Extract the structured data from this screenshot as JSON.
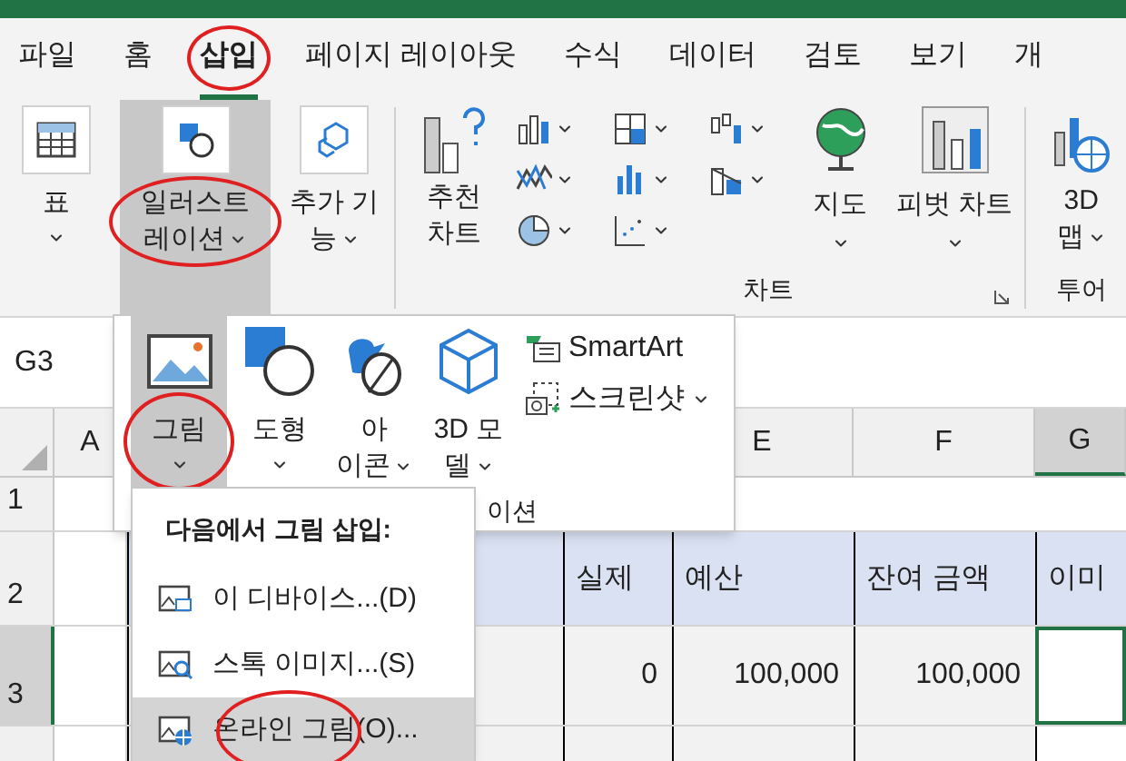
{
  "tabs": [
    {
      "label": "파일",
      "selected": false,
      "circled": false
    },
    {
      "label": "홈",
      "selected": false,
      "circled": false
    },
    {
      "label": "삽입",
      "selected": true,
      "circled": true
    },
    {
      "label": "페이지 레이아웃",
      "selected": false,
      "circled": false
    },
    {
      "label": "수식",
      "selected": false,
      "circled": false
    },
    {
      "label": "데이터",
      "selected": false,
      "circled": false
    },
    {
      "label": "검토",
      "selected": false,
      "circled": false
    },
    {
      "label": "보기",
      "selected": false,
      "circled": false
    },
    {
      "label": "개",
      "selected": false,
      "circled": false
    }
  ],
  "ribbon": {
    "left_buttons": [
      {
        "kind": "table",
        "lines": [
          "표"
        ],
        "pressed": false,
        "circled": false
      },
      {
        "kind": "illustration",
        "lines": [
          "일러스트",
          "레이션"
        ],
        "pressed": true,
        "circled": true
      },
      {
        "kind": "addin",
        "lines": [
          "추가 기",
          "능"
        ],
        "pressed": false,
        "circled": false
      }
    ],
    "charts_group": {
      "recommended": [
        "추천",
        "차트"
      ],
      "map": "지도",
      "pivot": "피벗 차트",
      "label": "차트"
    },
    "tour_group": {
      "button": [
        "3D",
        "맵"
      ],
      "label": "투어"
    }
  },
  "name_box": "G3",
  "gallery": {
    "items": [
      {
        "kind": "picture",
        "lines": [
          "그림"
        ],
        "pressed": true,
        "circled": true
      },
      {
        "kind": "shapes",
        "lines": [
          "도형"
        ],
        "pressed": false,
        "circled": false
      },
      {
        "kind": "icons",
        "lines": [
          "아",
          "이콘"
        ],
        "pressed": false,
        "circled": false
      },
      {
        "kind": "model3d",
        "lines": [
          "3D 모",
          "델"
        ],
        "pressed": false,
        "circled": false
      }
    ],
    "smartart": "SmartArt",
    "screenshot": "스크린샷",
    "group_label": "이션"
  },
  "picture_menu": {
    "title": "다음에서 그림 삽입:",
    "items": [
      {
        "kind": "device",
        "label": "이 디바이스...(D)",
        "selected": false,
        "circled": false
      },
      {
        "kind": "stock",
        "label": "스톡 이미지...(S)",
        "selected": false,
        "circled": false
      },
      {
        "kind": "online",
        "label": "온라인 그림(O)...",
        "selected": true,
        "circled": true
      }
    ]
  },
  "column_headers": [
    {
      "label": "A",
      "selected": false
    },
    {
      "label": "E",
      "selected": false
    },
    {
      "label": "F",
      "selected": false
    },
    {
      "label": "G",
      "selected": true
    }
  ],
  "rows": [
    {
      "label": "1",
      "kind": "empty",
      "selected": false
    },
    {
      "label": "2",
      "kind": "header",
      "selected": false,
      "cells": [
        "실제",
        "예산",
        "잔여 금액",
        "이미"
      ]
    },
    {
      "label": "3",
      "kind": "data",
      "selected": true,
      "cells": [
        "0",
        "100,000",
        "100,000"
      ]
    }
  ]
}
